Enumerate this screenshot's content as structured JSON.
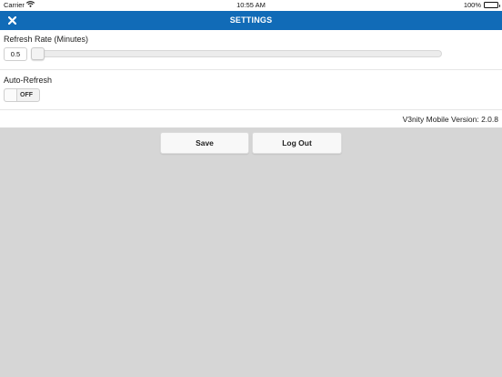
{
  "status_bar": {
    "carrier": "Carrier",
    "wifi_icon": "wifi-icon",
    "time": "10:55 AM",
    "battery": "100%",
    "battery_icon": "battery-icon"
  },
  "header": {
    "title": "SETTINGS",
    "close_icon": "close-icon",
    "color": "#116bb7"
  },
  "refresh_rate": {
    "label": "Refresh Rate (Minutes)",
    "value": "0.5",
    "slider_fraction": 0.0
  },
  "auto_refresh": {
    "label": "Auto-Refresh",
    "state": "OFF"
  },
  "version": {
    "text": "V3nity Mobile Version: 2.0.8"
  },
  "buttons": {
    "save": "Save",
    "logout": "Log Out"
  }
}
